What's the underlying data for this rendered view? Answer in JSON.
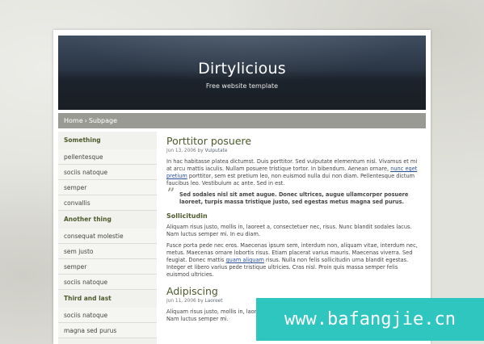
{
  "header": {
    "title": "Dirtylicious",
    "tagline": "Free website template"
  },
  "breadcrumb": {
    "home": "Home",
    "separator": "›",
    "current": "Subpage"
  },
  "sidebar": {
    "sections": [
      {
        "heading": "Something",
        "items": [
          "pellentesque",
          "sociis natoque",
          "semper",
          "convallis"
        ]
      },
      {
        "heading": "Another thing",
        "items": [
          "consequat molestie",
          "sem justo",
          "semper",
          "sociis natoque"
        ]
      },
      {
        "heading": "Third and last",
        "items": [
          "sociis natoque",
          "magna sed purus"
        ]
      }
    ]
  },
  "post1": {
    "title": "Porttitor posuere",
    "meta_date": "Jun 13, 2006 by",
    "meta_author": "Vulputate",
    "p1_before": "In hac habitasse platea dictumst. Duis porttitor. Sed vulputate elementum nisl. Vivamus et mi at arcu mattis iaculis. Nullam posuere tristique tortor. In bibendum. Aenean ornare, ",
    "p1_link": "nunc eget pretium",
    "p1_after": " porttitor, sem est pretium leo, non euismod nulla dui non diam. Pellentesque dictum faucibus leo. Vestibulum ac ante. Sed in est.",
    "quote": "Sed sodales nisl sit amet augue. Donec ultrices, augue ullamcorper posuere laoreet, turpis massa tristique justo, sed egestas metus magna sed purus.",
    "subheading": "Sollicitudin",
    "p2": "Aliquam risus justo, mollis in, laoreet a, consectetuer nec, risus. Nunc blandit sodales lacus. Nam luctus semper mi. In eu diam.",
    "p3_before": "Fusce porta pede nec eros. Maecenas ipsum sem, interdum non, aliquam vitae, interdum nec, metus. Maecenas ornare lobortis risus. Etiam placerat varius mauris. Maecenas viverra. Sed feugiat. Donec mattis ",
    "p3_link": "quam aliquam",
    "p3_after": " risus. Nulla non felis sollicitudin urna blandit egestas. Integer et libero varius pede tristique ultricies. Cras nisl. Proin quis massa semper felis euismod ultricies."
  },
  "post2": {
    "title": "Adipiscing",
    "meta_date": "Jun 11, 2006 by",
    "meta_author": "Laoreet",
    "p1": "Aliquam risus justo, mollis in, laoreet a, consectetuer nec, risus. Nunc blandit sodales lacus. Nam luctus semper mi."
  },
  "watermark": "www.bafangjie.cn"
}
